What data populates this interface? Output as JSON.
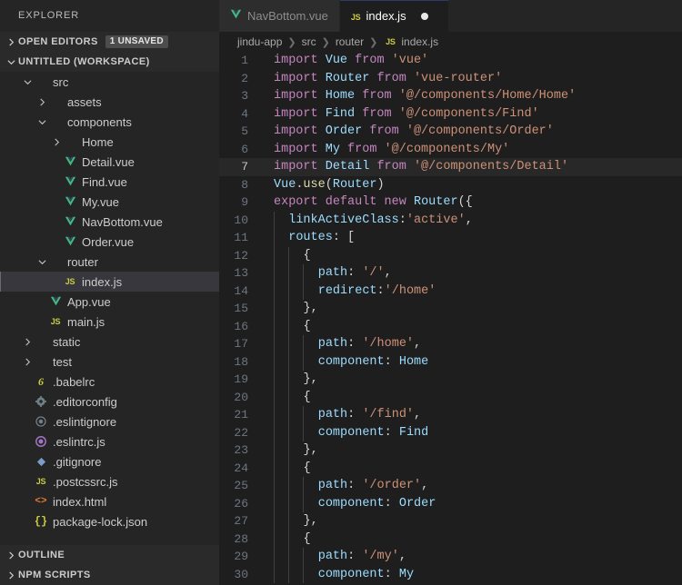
{
  "sidebar": {
    "title": "EXPLORER",
    "sections": [
      {
        "label": "OPEN EDITORS",
        "badge": "1 UNSAVED",
        "expanded": false
      },
      {
        "label": "UNTITLED (WORKSPACE)",
        "badge": "",
        "expanded": true
      }
    ],
    "bottom_sections": [
      {
        "label": "OUTLINE"
      },
      {
        "label": "NPM SCRIPTS"
      }
    ],
    "tree": [
      {
        "label": "src",
        "indent": 1,
        "arrow": "down",
        "icon": "none",
        "selected": false
      },
      {
        "label": "assets",
        "indent": 2,
        "arrow": "right",
        "icon": "none",
        "selected": false
      },
      {
        "label": "components",
        "indent": 2,
        "arrow": "down",
        "icon": "none",
        "selected": false
      },
      {
        "label": "Home",
        "indent": 3,
        "arrow": "right",
        "icon": "none",
        "selected": false
      },
      {
        "label": "Detail.vue",
        "indent": 3,
        "arrow": "none",
        "icon": "vue-icon",
        "selected": false
      },
      {
        "label": "Find.vue",
        "indent": 3,
        "arrow": "none",
        "icon": "vue-icon",
        "selected": false
      },
      {
        "label": "My.vue",
        "indent": 3,
        "arrow": "none",
        "icon": "vue-icon",
        "selected": false
      },
      {
        "label": "NavBottom.vue",
        "indent": 3,
        "arrow": "none",
        "icon": "vue-icon",
        "selected": false
      },
      {
        "label": "Order.vue",
        "indent": 3,
        "arrow": "none",
        "icon": "vue-icon",
        "selected": false
      },
      {
        "label": "router",
        "indent": 2,
        "arrow": "down",
        "icon": "none",
        "selected": false
      },
      {
        "label": "index.js",
        "indent": 3,
        "arrow": "none",
        "icon": "js-icon",
        "selected": true
      },
      {
        "label": "App.vue",
        "indent": 2,
        "arrow": "none",
        "icon": "vue-icon",
        "selected": false
      },
      {
        "label": "main.js",
        "indent": 2,
        "arrow": "none",
        "icon": "js-icon",
        "selected": false
      },
      {
        "label": "static",
        "indent": 1,
        "arrow": "right",
        "icon": "none",
        "selected": false
      },
      {
        "label": "test",
        "indent": 1,
        "arrow": "right",
        "icon": "none",
        "selected": false
      },
      {
        "label": ".babelrc",
        "indent": 1,
        "arrow": "none",
        "icon": "babel-icon",
        "selected": false
      },
      {
        "label": ".editorconfig",
        "indent": 1,
        "arrow": "none",
        "icon": "gear-icon",
        "selected": false
      },
      {
        "label": ".eslintignore",
        "indent": 1,
        "arrow": "none",
        "icon": "circle-icon",
        "selected": false
      },
      {
        "label": ".eslintrc.js",
        "indent": 1,
        "arrow": "none",
        "icon": "eslint-icon",
        "selected": false
      },
      {
        "label": ".gitignore",
        "indent": 1,
        "arrow": "none",
        "icon": "diamond-icon",
        "selected": false
      },
      {
        "label": ".postcssrc.js",
        "indent": 1,
        "arrow": "none",
        "icon": "js-icon",
        "selected": false
      },
      {
        "label": "index.html",
        "indent": 1,
        "arrow": "none",
        "icon": "html-icon",
        "selected": false
      },
      {
        "label": "package-lock.json",
        "indent": 1,
        "arrow": "none",
        "icon": "json-icon",
        "selected": false
      }
    ]
  },
  "tabs": [
    {
      "label": "NavBottom.vue",
      "icon": "vue-icon",
      "active": false,
      "dirty": false
    },
    {
      "label": "index.js",
      "icon": "js-icon",
      "active": true,
      "dirty": true
    }
  ],
  "breadcrumb": [
    {
      "label": "jindu-app",
      "icon": "none"
    },
    {
      "label": "src",
      "icon": "none"
    },
    {
      "label": "router",
      "icon": "none"
    },
    {
      "label": "index.js",
      "icon": "js-icon"
    }
  ],
  "breadcrumb_separator": "❯",
  "editor": {
    "language": "javascript",
    "active_line": 7,
    "first_line": 1,
    "lines": [
      {
        "n": 1,
        "indent": 0,
        "tokens": [
          {
            "t": "key",
            "v": "import"
          },
          {
            "t": "plain",
            "v": " "
          },
          {
            "t": "var",
            "v": "Vue"
          },
          {
            "t": "plain",
            "v": " "
          },
          {
            "t": "key",
            "v": "from"
          },
          {
            "t": "plain",
            "v": " "
          },
          {
            "t": "str",
            "v": "'vue'"
          }
        ]
      },
      {
        "n": 2,
        "indent": 0,
        "tokens": [
          {
            "t": "key",
            "v": "import"
          },
          {
            "t": "plain",
            "v": " "
          },
          {
            "t": "var",
            "v": "Router"
          },
          {
            "t": "plain",
            "v": " "
          },
          {
            "t": "key",
            "v": "from"
          },
          {
            "t": "plain",
            "v": " "
          },
          {
            "t": "str",
            "v": "'vue-router'"
          }
        ]
      },
      {
        "n": 3,
        "indent": 0,
        "tokens": [
          {
            "t": "key",
            "v": "import"
          },
          {
            "t": "plain",
            "v": " "
          },
          {
            "t": "var",
            "v": "Home"
          },
          {
            "t": "plain",
            "v": " "
          },
          {
            "t": "key",
            "v": "from"
          },
          {
            "t": "plain",
            "v": " "
          },
          {
            "t": "str",
            "v": "'@/components/Home/Home'"
          }
        ]
      },
      {
        "n": 4,
        "indent": 0,
        "tokens": [
          {
            "t": "key",
            "v": "import"
          },
          {
            "t": "plain",
            "v": " "
          },
          {
            "t": "var",
            "v": "Find"
          },
          {
            "t": "plain",
            "v": " "
          },
          {
            "t": "key",
            "v": "from"
          },
          {
            "t": "plain",
            "v": " "
          },
          {
            "t": "str",
            "v": "'@/components/Find'"
          }
        ]
      },
      {
        "n": 5,
        "indent": 0,
        "tokens": [
          {
            "t": "key",
            "v": "import"
          },
          {
            "t": "plain",
            "v": " "
          },
          {
            "t": "var",
            "v": "Order"
          },
          {
            "t": "plain",
            "v": " "
          },
          {
            "t": "key",
            "v": "from"
          },
          {
            "t": "plain",
            "v": " "
          },
          {
            "t": "str",
            "v": "'@/components/Order'"
          }
        ]
      },
      {
        "n": 6,
        "indent": 0,
        "tokens": [
          {
            "t": "key",
            "v": "import"
          },
          {
            "t": "plain",
            "v": " "
          },
          {
            "t": "var",
            "v": "My"
          },
          {
            "t": "plain",
            "v": " "
          },
          {
            "t": "key",
            "v": "from"
          },
          {
            "t": "plain",
            "v": " "
          },
          {
            "t": "str",
            "v": "'@/components/My'"
          }
        ]
      },
      {
        "n": 7,
        "indent": 0,
        "tokens": [
          {
            "t": "key",
            "v": "import"
          },
          {
            "t": "plain",
            "v": " "
          },
          {
            "t": "var",
            "v": "Detail"
          },
          {
            "t": "plain",
            "v": " "
          },
          {
            "t": "key",
            "v": "from"
          },
          {
            "t": "plain",
            "v": " "
          },
          {
            "t": "str",
            "v": "'@/components/Detail'"
          }
        ]
      },
      {
        "n": 8,
        "indent": 0,
        "tokens": [
          {
            "t": "var",
            "v": "Vue"
          },
          {
            "t": "punc",
            "v": "."
          },
          {
            "t": "fn2",
            "v": "use"
          },
          {
            "t": "punc",
            "v": "("
          },
          {
            "t": "var",
            "v": "Router"
          },
          {
            "t": "punc",
            "v": ")"
          }
        ]
      },
      {
        "n": 9,
        "indent": 0,
        "tokens": [
          {
            "t": "key",
            "v": "export"
          },
          {
            "t": "plain",
            "v": " "
          },
          {
            "t": "key",
            "v": "default"
          },
          {
            "t": "plain",
            "v": " "
          },
          {
            "t": "key2",
            "v": "new"
          },
          {
            "t": "plain",
            "v": " "
          },
          {
            "t": "var",
            "v": "Router"
          },
          {
            "t": "punc",
            "v": "({"
          }
        ]
      },
      {
        "n": 10,
        "indent": 1,
        "tokens": [
          {
            "t": "prop",
            "v": "linkActiveClass"
          },
          {
            "t": "punc",
            "v": ":"
          },
          {
            "t": "str",
            "v": "'active'"
          },
          {
            "t": "punc",
            "v": ","
          }
        ]
      },
      {
        "n": 11,
        "indent": 1,
        "tokens": [
          {
            "t": "prop",
            "v": "routes"
          },
          {
            "t": "punc",
            "v": ": ["
          }
        ]
      },
      {
        "n": 12,
        "indent": 2,
        "tokens": [
          {
            "t": "punc",
            "v": "{"
          }
        ]
      },
      {
        "n": 13,
        "indent": 3,
        "tokens": [
          {
            "t": "prop",
            "v": "path"
          },
          {
            "t": "punc",
            "v": ": "
          },
          {
            "t": "str",
            "v": "'/'"
          },
          {
            "t": "punc",
            "v": ","
          }
        ]
      },
      {
        "n": 14,
        "indent": 3,
        "tokens": [
          {
            "t": "prop",
            "v": "redirect"
          },
          {
            "t": "punc",
            "v": ":"
          },
          {
            "t": "str",
            "v": "'/home'"
          }
        ]
      },
      {
        "n": 15,
        "indent": 2,
        "tokens": [
          {
            "t": "punc",
            "v": "},"
          }
        ]
      },
      {
        "n": 16,
        "indent": 2,
        "tokens": [
          {
            "t": "punc",
            "v": "{"
          }
        ]
      },
      {
        "n": 17,
        "indent": 3,
        "tokens": [
          {
            "t": "prop",
            "v": "path"
          },
          {
            "t": "punc",
            "v": ": "
          },
          {
            "t": "str",
            "v": "'/home'"
          },
          {
            "t": "punc",
            "v": ","
          }
        ]
      },
      {
        "n": 18,
        "indent": 3,
        "tokens": [
          {
            "t": "prop",
            "v": "component"
          },
          {
            "t": "punc",
            "v": ": "
          },
          {
            "t": "var",
            "v": "Home"
          }
        ]
      },
      {
        "n": 19,
        "indent": 2,
        "tokens": [
          {
            "t": "punc",
            "v": "},"
          }
        ]
      },
      {
        "n": 20,
        "indent": 2,
        "tokens": [
          {
            "t": "punc",
            "v": "{"
          }
        ]
      },
      {
        "n": 21,
        "indent": 3,
        "tokens": [
          {
            "t": "prop",
            "v": "path"
          },
          {
            "t": "punc",
            "v": ": "
          },
          {
            "t": "str",
            "v": "'/find'"
          },
          {
            "t": "punc",
            "v": ","
          }
        ]
      },
      {
        "n": 22,
        "indent": 3,
        "tokens": [
          {
            "t": "prop",
            "v": "component"
          },
          {
            "t": "punc",
            "v": ": "
          },
          {
            "t": "var",
            "v": "Find"
          }
        ]
      },
      {
        "n": 23,
        "indent": 2,
        "tokens": [
          {
            "t": "punc",
            "v": "},"
          }
        ]
      },
      {
        "n": 24,
        "indent": 2,
        "tokens": [
          {
            "t": "punc",
            "v": "{"
          }
        ]
      },
      {
        "n": 25,
        "indent": 3,
        "tokens": [
          {
            "t": "prop",
            "v": "path"
          },
          {
            "t": "punc",
            "v": ": "
          },
          {
            "t": "str",
            "v": "'/order'"
          },
          {
            "t": "punc",
            "v": ","
          }
        ]
      },
      {
        "n": 26,
        "indent": 3,
        "tokens": [
          {
            "t": "prop",
            "v": "component"
          },
          {
            "t": "punc",
            "v": ": "
          },
          {
            "t": "var",
            "v": "Order"
          }
        ]
      },
      {
        "n": 27,
        "indent": 2,
        "tokens": [
          {
            "t": "punc",
            "v": "},"
          }
        ]
      },
      {
        "n": 28,
        "indent": 2,
        "tokens": [
          {
            "t": "punc",
            "v": "{"
          }
        ]
      },
      {
        "n": 29,
        "indent": 3,
        "tokens": [
          {
            "t": "prop",
            "v": "path"
          },
          {
            "t": "punc",
            "v": ": "
          },
          {
            "t": "str",
            "v": "'/my'"
          },
          {
            "t": "punc",
            "v": ","
          }
        ]
      },
      {
        "n": 30,
        "indent": 3,
        "tokens": [
          {
            "t": "prop",
            "v": "component"
          },
          {
            "t": "punc",
            "v": ": "
          },
          {
            "t": "var",
            "v": "My"
          }
        ]
      }
    ]
  },
  "colors": {
    "editor_bg": "#1e1e1e",
    "sidebar_bg": "#252526",
    "tab_inactive_bg": "#2d2d2d",
    "selection_bg": "#37373d",
    "keyword": "#c586c0",
    "variable": "#9cdcfe",
    "string": "#ce9178",
    "function": "#dcdcaa",
    "vue_green": "#41b883",
    "js_yellow": "#cbcb41",
    "html_orange": "#e37933"
  }
}
